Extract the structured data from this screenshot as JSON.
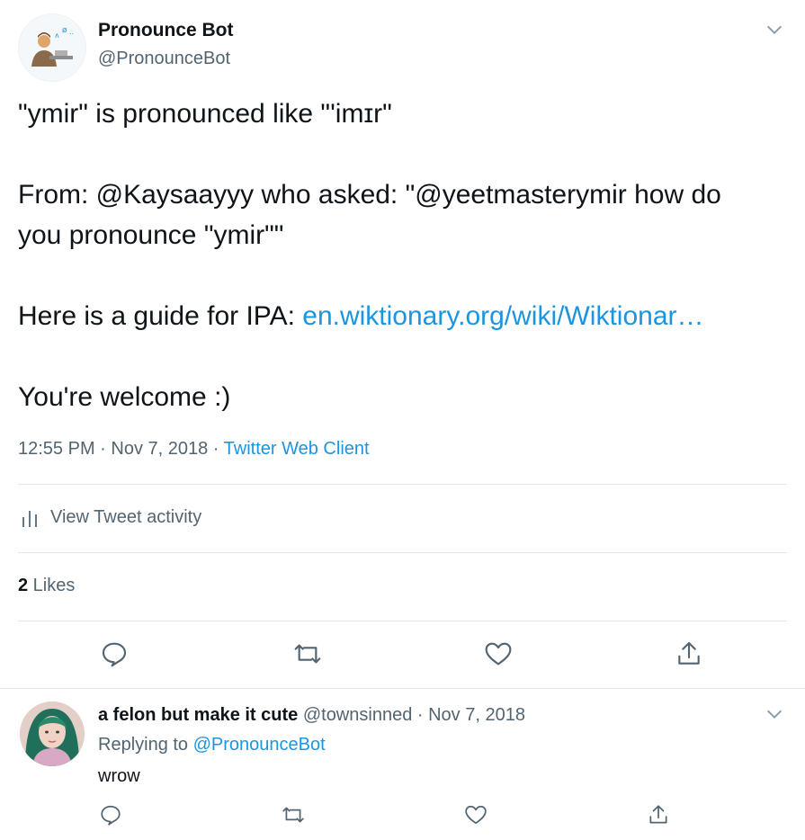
{
  "main_tweet": {
    "author": {
      "name": "Pronounce Bot",
      "handle": "@PronounceBot"
    },
    "lines": {
      "l1": "\"ymir\" is pronounced like \"'imɪr\"",
      "l2": "From: @Kaysaayyy who asked: \"@yeetmasterymir how do",
      "l3": "you pronounce \"ymir\"\"",
      "l4_prefix": "Here is a guide for IPA: ",
      "l4_link": "en.wiktionary.org/wiki/Wiktionar…",
      "l5": "You're welcome :)"
    },
    "timestamp": "12:55 PM · Nov 7, 2018",
    "separator": " · ",
    "client": "Twitter Web Client",
    "activity_label": "View Tweet activity",
    "likes_count": "2",
    "likes_label": " Likes",
    "icons": [
      "reply-icon",
      "retweet-icon",
      "like-icon",
      "share-icon",
      "chevron-down-icon",
      "analytics-icon"
    ]
  },
  "reply_tweet": {
    "author": {
      "name": "a felon but make it cute",
      "handle": "@townsinned"
    },
    "date": " · Nov 7, 2018",
    "replying_to_label": "Replying to ",
    "replying_to_handle": "@PronounceBot",
    "text": "wrow"
  },
  "colors": {
    "link": "#1b95e0",
    "secondary": "#536471",
    "border": "#e1e8ed"
  }
}
